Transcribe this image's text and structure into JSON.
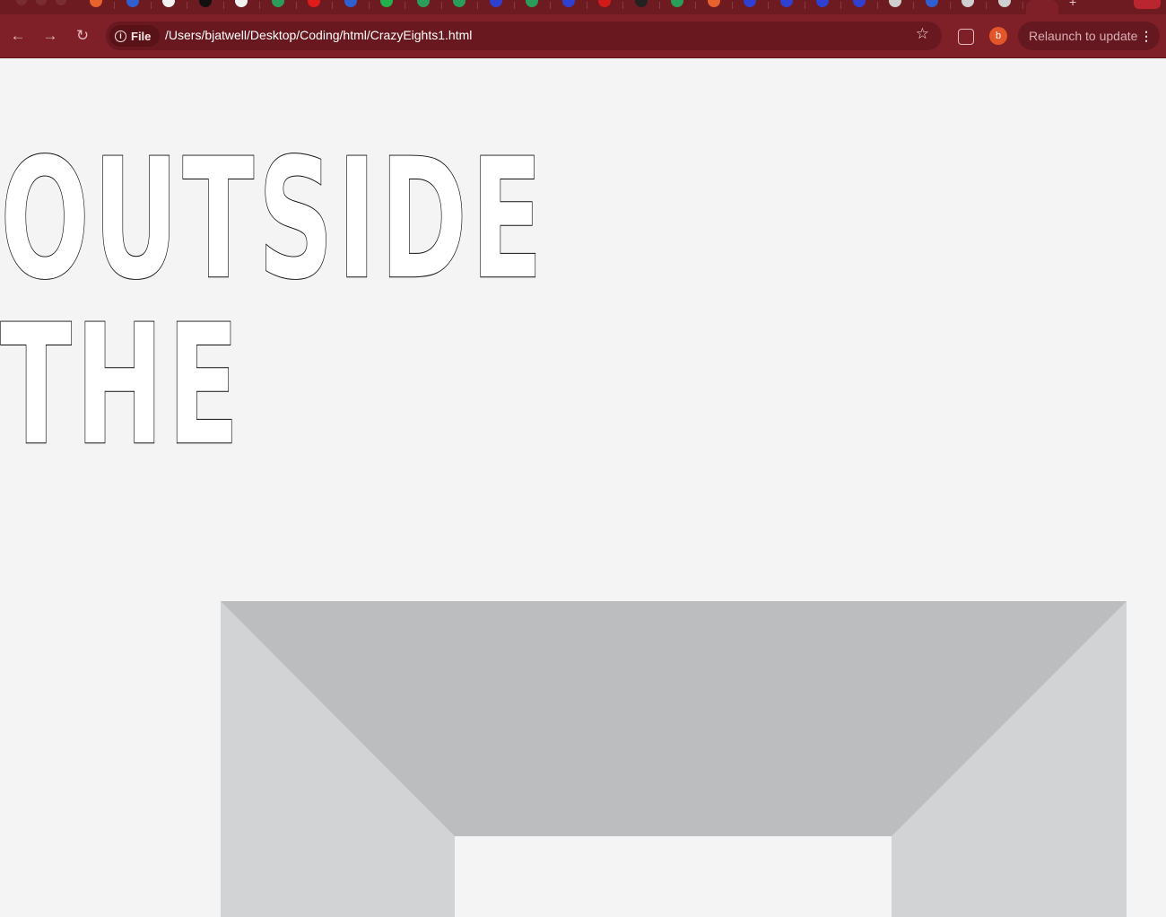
{
  "browser": {
    "theme_color": "#7f1f27",
    "site_chip_label": "File",
    "address": "/Users/bjatwell/Desktop/Coding/html/CrazyEights1.html",
    "profile_initial": "b",
    "relaunch_label": "Relaunch to update",
    "tab_favicon_colors": [
      "#e8622c",
      "#2f5fd0",
      "#f2f2f2",
      "#111111",
      "#f2f2f2",
      "#2a9d5a",
      "#e01b1b",
      "#2f5fd0",
      "#22b14c",
      "#2a9d5a",
      "#2a9d5a",
      "#2f3fd0",
      "#2a9d5a",
      "#2f3fd0",
      "#d21a1a",
      "#222222",
      "#2a9d5a",
      "#e8622c",
      "#2f3fd0",
      "#2f3fd0",
      "#2f3fd0",
      "#2f3fd0",
      "#cfcfcf",
      "#2f5fd0",
      "#cfcfcf",
      "#cfcfcf"
    ]
  },
  "page": {
    "heading_line1": "OUTSIDE",
    "heading_line2": "THE",
    "frame_colors": {
      "top": "#bcbdbf",
      "sides": "#d2d3d5"
    }
  }
}
